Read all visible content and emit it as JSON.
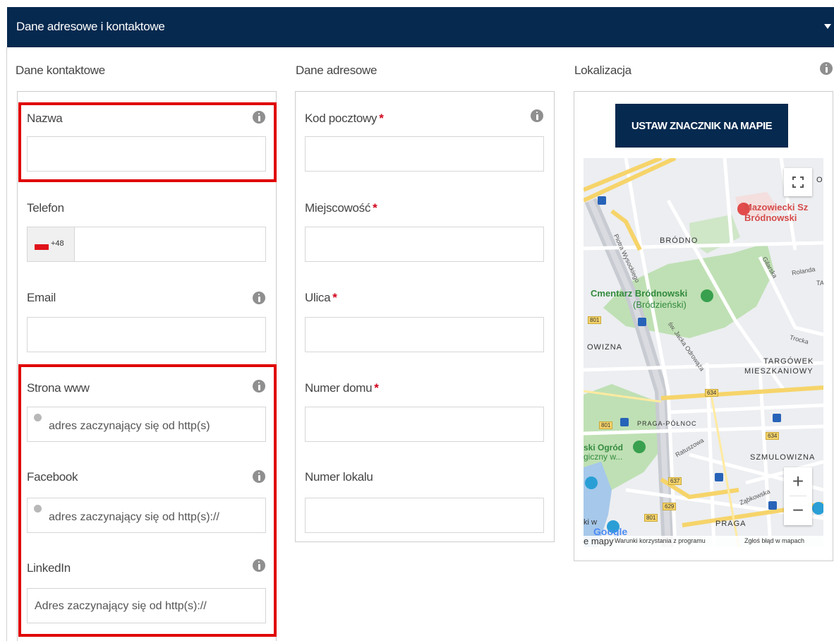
{
  "header": {
    "title": "Dane adresowe i kontaktowe"
  },
  "contact": {
    "title": "Dane kontaktowe",
    "name_label": "Nazwa",
    "phone_label": "Telefon",
    "phone_dial_code": "+48",
    "email_label": "Email",
    "www_label": "Strona www",
    "www_placeholder": "adres zaczynający się od http(s)",
    "facebook_label": "Facebook",
    "facebook_placeholder": "adres zaczynający się od http(s)://",
    "linkedin_label": "LinkedIn",
    "linkedin_placeholder": "Adres zaczynający się od http(s)://"
  },
  "address": {
    "title": "Dane adresowe",
    "postal_label": "Kod pocztowy",
    "city_label": "Miejscowość",
    "street_label": "Ulica",
    "house_label": "Numer domu",
    "apartment_label": "Numer lokalu",
    "required_mark": "*"
  },
  "location": {
    "title": "Lokalizacja",
    "button_label": "USTAW ZNACZNIK NA MAPIE",
    "zoom_in": "+",
    "zoom_out": "−",
    "map_labels": {
      "hospital_1": "Mazowiecki Sz",
      "hospital_2": "Bródnowski",
      "brodno": "BRÓDNO",
      "cemetery_1": "Cmentarz Bródnowski",
      "cemetery_2": "(Bródzieński)",
      "owizna": "OWIZNA",
      "targowek_1": "TARGÓWEK",
      "targowek_2": "MIESZKANIOWY",
      "praga_polnoc": "PRAGA-PÓŁNOC",
      "ogrod_1": "ski Ogród",
      "ogrod_2": "giczny w...",
      "szmulowizna": "SZMULOWIZNA",
      "praga": "PRAGA",
      "kiw": "ki w",
      "b_corner": "B",
      "o_corner": "O",
      "t_corner": "TA",
      "street_wysockiego": "Piotra Wysockiego",
      "street_odrowaza": "św. Jacka Odrowąża",
      "street_rolanda": "Rolanda",
      "street_gilarska": "Gilarska",
      "street_trocka": "Trocka",
      "street_ratuszowa": "Ratuszowa",
      "street_zabkowska": "Ząbkowska",
      "route_634a": "634",
      "route_634b": "634",
      "route_801a": "801",
      "route_801b": "801",
      "route_801c": "801",
      "route_637": "637",
      "route_629": "629",
      "google": "Google",
      "attr_maps": "e mapy",
      "attr_terms": "Warunki korzystania z programu",
      "attr_report": "Zgłoś błąd w mapach"
    }
  },
  "colors": {
    "header_bg": "#06294f",
    "highlight": "#e00000",
    "required": "#d0021b",
    "flag_red": "#e0121a"
  }
}
